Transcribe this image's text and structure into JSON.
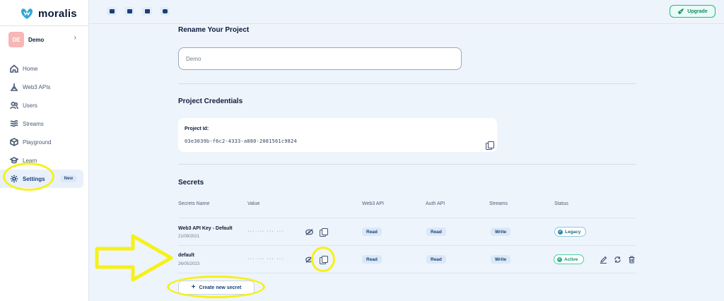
{
  "brand": {
    "logo_text": "moralis"
  },
  "project": {
    "initials": "DE",
    "name": "Demo",
    "chevron": "›"
  },
  "nav": [
    {
      "label": "Home",
      "icon": "home-icon"
    },
    {
      "label": "Web3 APIs",
      "icon": "web3-api-icon"
    },
    {
      "label": "Users",
      "icon": "users-icon"
    },
    {
      "label": "Streams",
      "icon": "streams-icon"
    },
    {
      "label": "Playground",
      "icon": "playground-icon"
    },
    {
      "label": "Learn",
      "icon": "learn-icon"
    },
    {
      "label": "Settings",
      "icon": "gear-icon",
      "badge": "New",
      "active": true
    }
  ],
  "topbar": {
    "icons": [
      "docs-icon",
      "forum-icon",
      "discord-icon",
      "youtube-icon"
    ],
    "upgrade_label": "Upgrade"
  },
  "rename": {
    "title": "Rename Your Project",
    "value": "Demo"
  },
  "credentials": {
    "title": "Project Credentials",
    "label": "Project Id:",
    "value": "03e3039b-f6c2-4333-a880-2081561c9824"
  },
  "secrets": {
    "title": "Secrets",
    "headers": [
      "Secrets Name",
      "Value",
      "Web3 API",
      "Auth API",
      "Streams",
      "Status"
    ],
    "rows": [
      {
        "name": "Web3 API Key - Default",
        "date": "21/09/2021",
        "value": "··· ··· ··· ···",
        "web3": "Read",
        "auth": "Read",
        "streams": "Write",
        "status": "Legacy"
      },
      {
        "name": "default",
        "date": "26/05/2023",
        "value": "··· ··· ··· ···",
        "web3": "Read",
        "auth": "Read",
        "streams": "Write",
        "status": "Active"
      }
    ],
    "create_label": "Create new secret"
  },
  "colors": {
    "accent": "#1a3f7a",
    "upgrade": "#25b58f",
    "annotation": "#f5f11a",
    "background": "#eef4fb"
  }
}
